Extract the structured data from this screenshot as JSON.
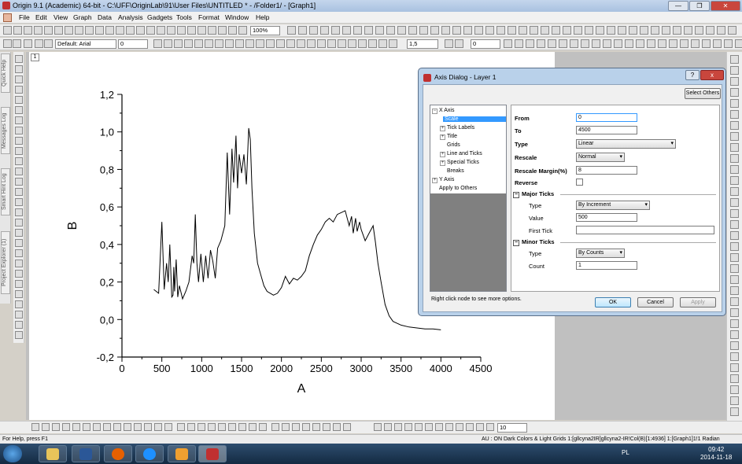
{
  "window": {
    "title": "Origin 9.1 (Academic) 64-bit - C:\\UFF\\OriginLab\\91\\User Files\\UNTITLED * - /Folder1/ - [Graph1]"
  },
  "menu": [
    "File",
    "Edit",
    "View",
    "Graph",
    "Data",
    "Analysis",
    "Gadgets",
    "Tools",
    "Format",
    "Window",
    "Help"
  ],
  "toolbar": {
    "zoom": "100%",
    "font": "Default: Arial",
    "font_size": "0",
    "line_width": "1,5",
    "border": "0",
    "bottom_zoom": "10"
  },
  "side_tabs": [
    "Quick Help",
    "Messages Log",
    "Smart Hint Log",
    "Project Explorer (1)"
  ],
  "layer_number": "1",
  "chart_data": {
    "type": "line",
    "xlabel": "A",
    "ylabel": "B",
    "xlim": [
      0,
      4500
    ],
    "ylim": [
      -0.2,
      1.2
    ],
    "xticks": [
      "0",
      "500",
      "1000",
      "1500",
      "2000",
      "2500",
      "3000",
      "3500",
      "4000",
      "4500"
    ],
    "yticks": [
      "-0,2",
      "0,0",
      "0,2",
      "0,4",
      "0,6",
      "0,8",
      "1,0",
      "1,2"
    ],
    "x": [
      400,
      460,
      500,
      530,
      560,
      580,
      600,
      625,
      640,
      650,
      660,
      680,
      700,
      720,
      760,
      800,
      840,
      880,
      900,
      920,
      940,
      960,
      990,
      1020,
      1050,
      1080,
      1110,
      1140,
      1170,
      1200,
      1240,
      1290,
      1320,
      1350,
      1380,
      1400,
      1430,
      1450,
      1470,
      1500,
      1530,
      1560,
      1590,
      1610,
      1630,
      1660,
      1700,
      1740,
      1780,
      1820,
      1860,
      1900,
      1950,
      2000,
      2050,
      2100,
      2150,
      2200,
      2250,
      2300,
      2350,
      2400,
      2450,
      2500,
      2550,
      2600,
      2650,
      2700,
      2750,
      2800,
      2850,
      2880,
      2900,
      2930,
      2950,
      2980,
      3000,
      3050,
      3100,
      3150,
      3180,
      3210,
      3250,
      3300,
      3350,
      3400,
      3450,
      3500,
      3600,
      3700,
      3800,
      3900,
      4000
    ],
    "y": [
      0.16,
      0.14,
      0.52,
      0.16,
      0.3,
      0.2,
      0.4,
      0.12,
      0.13,
      0.28,
      0.15,
      0.32,
      0.12,
      0.18,
      0.11,
      0.15,
      0.2,
      0.34,
      0.3,
      0.56,
      0.3,
      0.2,
      0.35,
      0.2,
      0.34,
      0.22,
      0.37,
      0.31,
      0.22,
      0.38,
      0.42,
      0.5,
      0.89,
      0.56,
      0.91,
      0.73,
      0.98,
      0.7,
      0.88,
      0.78,
      0.88,
      0.72,
      1.02,
      0.96,
      0.7,
      0.46,
      0.3,
      0.24,
      0.18,
      0.15,
      0.14,
      0.13,
      0.14,
      0.17,
      0.23,
      0.19,
      0.22,
      0.21,
      0.23,
      0.26,
      0.34,
      0.4,
      0.45,
      0.48,
      0.52,
      0.54,
      0.52,
      0.56,
      0.57,
      0.58,
      0.5,
      0.55,
      0.46,
      0.54,
      0.47,
      0.52,
      0.48,
      0.42,
      0.46,
      0.5,
      0.41,
      0.3,
      0.2,
      0.08,
      0.02,
      -0.01,
      -0.02,
      -0.03,
      -0.04,
      -0.045,
      -0.05,
      -0.05,
      -0.055
    ]
  },
  "dialog": {
    "title": "Axis Dialog - Layer 1",
    "help": "?",
    "close": "x",
    "select_others": "Select Others",
    "tree": {
      "x_axis": "X Axis",
      "items": [
        "Scale",
        "Tick Labels",
        "Title",
        "Grids",
        "Line and Ticks",
        "Special Ticks",
        "Breaks"
      ],
      "y_axis": "Y Axis",
      "apply": "Apply to Others"
    },
    "props": {
      "from_label": "From",
      "from_value": "0",
      "to_label": "To",
      "to_value": "4500",
      "type_label": "Type",
      "type_value": "Linear",
      "rescale_label": "Rescale",
      "rescale_value": "Normal",
      "margin_label": "Rescale Margin(%)",
      "margin_value": "8",
      "reverse_label": "Reverse",
      "major_label": "Major Ticks",
      "major_type_label": "Type",
      "major_type_value": "By Increment",
      "value_label": "Value",
      "value_value": "500",
      "first_tick_label": "First Tick",
      "minor_label": "Minor Ticks",
      "minor_type_label": "Type",
      "minor_type_value": "By Counts",
      "count_label": "Count",
      "count_value": "1"
    },
    "hint": "Right click node to see more options.",
    "ok": "OK",
    "cancel": "Cancel",
    "apply": "Apply"
  },
  "status": {
    "left": "For Help, press F1",
    "right": "AU : ON  Dark Colors & Light Grids  1:[gllcyna2IR]gllcyna2-IR!Col(B)[1:4936]  1:[Graph1]1!1  Radian"
  },
  "taskbar": {
    "lang": "PL",
    "time": "09:42",
    "date": "2014-11-18"
  }
}
